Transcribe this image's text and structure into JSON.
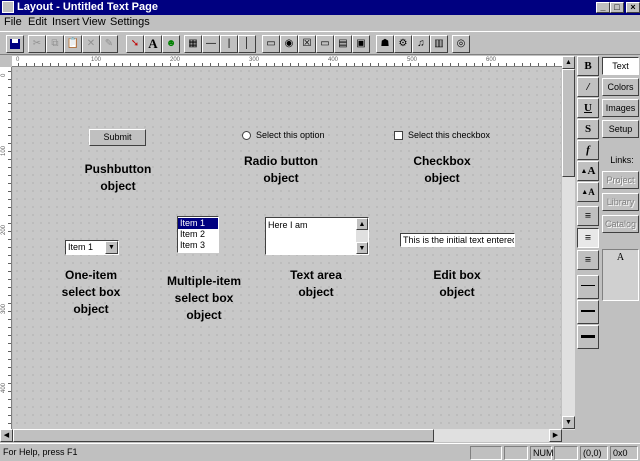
{
  "window": {
    "title": "Layout - Untitled Text Page",
    "controls": [
      "_",
      "□",
      "×"
    ]
  },
  "menu": [
    "File",
    "Edit",
    "Insert",
    "View",
    "Settings"
  ],
  "ruler": {
    "h_labels": [
      "0",
      "100",
      "200",
      "300",
      "400",
      "500",
      "600"
    ],
    "v_labels": [
      "0",
      "100",
      "200",
      "300",
      "400"
    ]
  },
  "canvas": {
    "pushbutton": {
      "label": "Submit",
      "caption_line1": "Pushbutton",
      "caption_line2": "object"
    },
    "radio": {
      "label": "Select this option",
      "caption_line1": "Radio button",
      "caption_line2": "object"
    },
    "checkbox": {
      "label": "Select this checkbox",
      "caption_line1": "Checkbox",
      "caption_line2": "object"
    },
    "select_one": {
      "value": "Item 1",
      "caption_line1": "One-item",
      "caption_line2": "select box",
      "caption_line3": "object"
    },
    "select_multi": {
      "items": [
        "Item 1",
        "Item 2",
        "Item 3"
      ],
      "selected_index": 0,
      "caption_line1": "Multiple-item",
      "caption_line2": "select box",
      "caption_line3": "object"
    },
    "textarea": {
      "value": "Here I am",
      "caption_line1": "Text area",
      "caption_line2": "object"
    },
    "editbox": {
      "value": "This is the initial text entered.",
      "caption_line1": "Edit box",
      "caption_line2": "object"
    }
  },
  "palette": {
    "bold": "B",
    "italic": "I",
    "underline": "U",
    "strike": "S",
    "fn": "f",
    "grow": "A",
    "shrink": "A"
  },
  "right_panel": {
    "tabs": [
      "Text",
      "Colors",
      "Images",
      "Setup"
    ],
    "links_label": "Links:",
    "links": [
      "Project",
      "Library",
      "Catalog"
    ],
    "font_preview": "A"
  },
  "status": {
    "help": "For Help, press F1",
    "num": "NUM",
    "coords": "(0,0)",
    "size": "0x0"
  }
}
